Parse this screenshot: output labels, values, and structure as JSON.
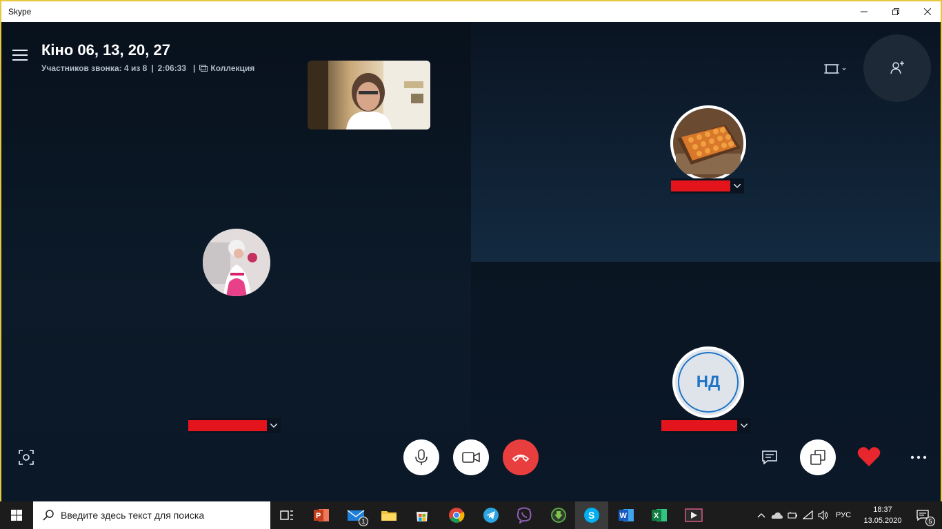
{
  "window": {
    "title": "Skype"
  },
  "call": {
    "title": "Кіно 06, 13, 20, 27",
    "participants": "Участников звонка: 4 из 8",
    "duration": "2:06:33",
    "separator": "|",
    "gallery_label": "Коллекция"
  },
  "participants": [
    {
      "id": "left",
      "avatar": "girl-pink-dress-photo"
    },
    {
      "id": "top-right",
      "avatar": "sushi-tray-photo"
    },
    {
      "id": "bottom-right",
      "initials": "НД"
    }
  ],
  "controls": {
    "mic": "microphone-icon",
    "video": "video-camera-icon",
    "hangup": "hang-up-icon",
    "chat": "chat-icon",
    "share": "share-screen-icon",
    "react": "heart-icon",
    "more": "more-dots-icon",
    "snapshot": "snapshot-icon",
    "layout": "layout-icon",
    "add_person": "add-person-icon"
  },
  "colors": {
    "accent": "#1d74c7",
    "hangup": "#e83e3e",
    "heart": "#e8262e",
    "redaction": "#e3141c"
  },
  "taskbar": {
    "search_placeholder": "Введите здесь текст для поиска",
    "language": "РУС",
    "time": "18:37",
    "date": "13.05.2020",
    "mail_badge": "1",
    "notification_badge": "5"
  }
}
